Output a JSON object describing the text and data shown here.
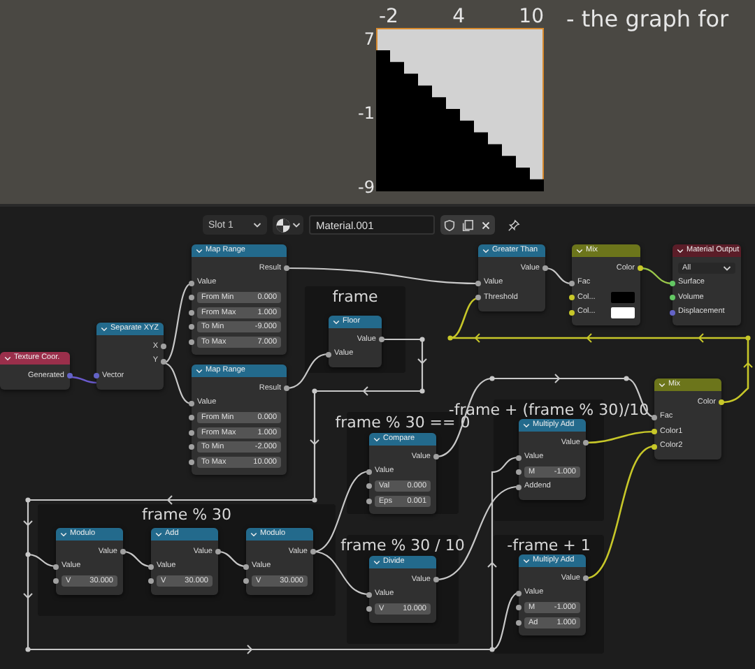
{
  "graph": {
    "x_ticks": [
      "-2",
      "4",
      "10"
    ],
    "y_ticks": [
      "7",
      "-1",
      "-9"
    ],
    "caption": "- the graph for"
  },
  "header": {
    "slot": "Slot 1",
    "material": "Material.001"
  },
  "frames": [
    {
      "label": "frame"
    },
    {
      "label": "frame % 30"
    },
    {
      "label": "frame % 30 == 0"
    },
    {
      "label": "frame % 30 / 10"
    },
    {
      "label": "-frame + (frame % 30)/10"
    },
    {
      "label": "-frame + 1"
    }
  ],
  "nodes": [
    {
      "title": "Texture Coor.",
      "kind": "input",
      "rows": [
        {
          "kind": "out",
          "label": "Generated",
          "color": "#6363c7"
        }
      ]
    },
    {
      "title": "Separate XYZ",
      "kind": "converter",
      "rows": [
        {
          "kind": "out",
          "label": "X",
          "color": "#a1a1a1"
        },
        {
          "kind": "out",
          "label": "Y",
          "color": "#a1a1a1"
        },
        {
          "kind": "in",
          "label": "Vector",
          "color": "#6363c7"
        }
      ]
    },
    {
      "title": "Map Range",
      "kind": "converter",
      "rows": [
        {
          "kind": "out",
          "label": "Result",
          "color": "#a1a1a1"
        },
        {
          "kind": "in",
          "label": "Value",
          "color": "#a1a1a1"
        },
        {
          "kind": "field",
          "label": "From Min",
          "value": "0.000",
          "color": "#a1a1a1"
        },
        {
          "kind": "field",
          "label": "From Max",
          "value": "1.000",
          "color": "#a1a1a1"
        },
        {
          "kind": "field",
          "label": "To Min",
          "value": "-9.000",
          "color": "#a1a1a1"
        },
        {
          "kind": "field",
          "label": "To Max",
          "value": "7.000",
          "color": "#a1a1a1"
        }
      ]
    },
    {
      "title": "Map Range",
      "kind": "converter",
      "rows": [
        {
          "kind": "out",
          "label": "Result",
          "color": "#a1a1a1"
        },
        {
          "kind": "in",
          "label": "Value",
          "color": "#a1a1a1"
        },
        {
          "kind": "field",
          "label": "From Min",
          "value": "0.000",
          "color": "#a1a1a1"
        },
        {
          "kind": "field",
          "label": "From Max",
          "value": "1.000",
          "color": "#a1a1a1"
        },
        {
          "kind": "field",
          "label": "To Min",
          "value": "-2.000",
          "color": "#a1a1a1"
        },
        {
          "kind": "field",
          "label": "To Max",
          "value": "10.000",
          "color": "#a1a1a1"
        }
      ]
    },
    {
      "title": "Floor",
      "kind": "converter",
      "rows": [
        {
          "kind": "out",
          "label": "Value",
          "color": "#a1a1a1"
        },
        {
          "kind": "in",
          "label": "Value",
          "color": "#a1a1a1"
        }
      ]
    },
    {
      "title": "Greater Than",
      "kind": "converter",
      "rows": [
        {
          "kind": "out",
          "label": "Value",
          "color": "#a1a1a1"
        },
        {
          "kind": "in",
          "label": "Value",
          "color": "#a1a1a1"
        },
        {
          "kind": "in",
          "label": "Threshold",
          "color": "#a1a1a1"
        }
      ]
    },
    {
      "title": "Mix",
      "kind": "shader",
      "rows": [
        {
          "kind": "out",
          "label": "Color",
          "color": "#c7c729"
        },
        {
          "kind": "in",
          "label": "Fac",
          "color": "#a1a1a1"
        },
        {
          "kind": "swatch",
          "label": "Col...",
          "swatch": {
            "color": "#000000"
          },
          "color": "#c7c729"
        },
        {
          "kind": "swatch",
          "label": "Col...",
          "swatch": {
            "color": "#ffffff"
          },
          "color": "#c7c729"
        }
      ]
    },
    {
      "title": "Material Output",
      "kind": "output",
      "rows": [
        {
          "kind": "select",
          "value": "All"
        },
        {
          "kind": "in",
          "label": "Surface",
          "color": "#63c763"
        },
        {
          "kind": "in",
          "label": "Volume",
          "color": "#63c763"
        },
        {
          "kind": "in",
          "label": "Displacement",
          "color": "#6363c7"
        }
      ]
    },
    {
      "title": "Modulo",
      "kind": "converter",
      "rows": [
        {
          "kind": "out",
          "label": "Value",
          "color": "#a1a1a1"
        },
        {
          "kind": "in",
          "label": "Value",
          "color": "#a1a1a1"
        },
        {
          "kind": "field",
          "label": "V",
          "value": "30.000",
          "color": "#a1a1a1"
        }
      ]
    },
    {
      "title": "Add",
      "kind": "converter",
      "rows": [
        {
          "kind": "out",
          "label": "Value",
          "color": "#a1a1a1"
        },
        {
          "kind": "in",
          "label": "Value",
          "color": "#a1a1a1"
        },
        {
          "kind": "field",
          "label": "V",
          "value": "30.000",
          "color": "#a1a1a1"
        }
      ]
    },
    {
      "title": "Modulo",
      "kind": "converter",
      "rows": [
        {
          "kind": "out",
          "label": "Value",
          "color": "#a1a1a1"
        },
        {
          "kind": "in",
          "label": "Value",
          "color": "#a1a1a1"
        },
        {
          "kind": "field",
          "label": "V",
          "value": "30.000",
          "color": "#a1a1a1"
        }
      ]
    },
    {
      "title": "Compare",
      "kind": "converter",
      "rows": [
        {
          "kind": "out",
          "label": "Value",
          "color": "#a1a1a1"
        },
        {
          "kind": "in",
          "label": "Value",
          "color": "#a1a1a1"
        },
        {
          "kind": "field",
          "label": "Val",
          "value": "0.000",
          "color": "#a1a1a1"
        },
        {
          "kind": "field",
          "label": "Eps",
          "value": "0.001",
          "color": "#a1a1a1"
        }
      ]
    },
    {
      "title": "Divide",
      "kind": "converter",
      "rows": [
        {
          "kind": "out",
          "label": "Value",
          "color": "#a1a1a1"
        },
        {
          "kind": "in",
          "label": "Value",
          "color": "#a1a1a1"
        },
        {
          "kind": "field",
          "label": "V",
          "value": "10.000",
          "color": "#a1a1a1"
        }
      ]
    },
    {
      "title": "Multiply Add",
      "kind": "converter",
      "rows": [
        {
          "kind": "out",
          "label": "Value",
          "color": "#a1a1a1"
        },
        {
          "kind": "in",
          "label": "Value",
          "color": "#a1a1a1"
        },
        {
          "kind": "field",
          "label": "M",
          "value": "-1.000",
          "color": "#a1a1a1"
        },
        {
          "kind": "in",
          "label": "Addend",
          "color": "#a1a1a1"
        }
      ]
    },
    {
      "title": "Multiply Add",
      "kind": "converter",
      "rows": [
        {
          "kind": "out",
          "label": "Value",
          "color": "#a1a1a1"
        },
        {
          "kind": "in",
          "label": "Value",
          "color": "#a1a1a1"
        },
        {
          "kind": "field",
          "label": "M",
          "value": "-1.000",
          "color": "#a1a1a1"
        },
        {
          "kind": "field",
          "label": "Ad",
          "value": "1.000",
          "color": "#a1a1a1"
        }
      ]
    },
    {
      "title": "Mix",
      "kind": "shader",
      "rows": [
        {
          "kind": "out",
          "label": "Color",
          "color": "#c7c729"
        },
        {
          "kind": "in",
          "label": "Fac",
          "color": "#a1a1a1"
        },
        {
          "kind": "in",
          "label": "Color1",
          "color": "#c7c729"
        },
        {
          "kind": "in",
          "label": "Color2",
          "color": "#c7c729"
        }
      ]
    }
  ]
}
